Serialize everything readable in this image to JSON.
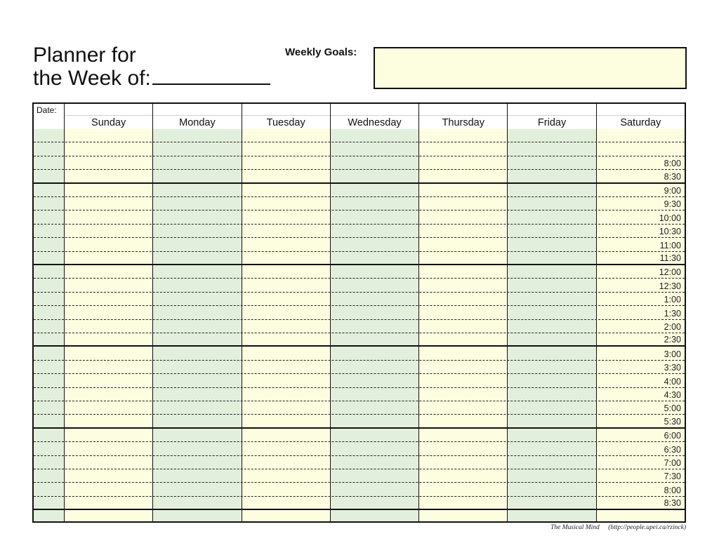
{
  "title": {
    "line1": "Planner for",
    "line2": "the Week of:"
  },
  "weekly_goals": {
    "label": "Weekly Goals:",
    "value": ""
  },
  "grid": {
    "date_label": "Date:",
    "days": [
      "Sunday",
      "Monday",
      "Tuesday",
      "Wednesday",
      "Thursday",
      "Friday",
      "Saturday"
    ],
    "day_shading": [
      "yellow",
      "green",
      "yellow",
      "green",
      "yellow",
      "green",
      "yellow"
    ],
    "blocks": [
      [
        "",
        "",
        "8:00",
        "8:30"
      ],
      [
        "9:00",
        "9:30",
        "10:00",
        "10:30",
        "11:00",
        "11:30"
      ],
      [
        "12:00",
        "12:30",
        "1:00",
        "1:30",
        "2:00",
        "2:30"
      ],
      [
        "3:00",
        "3:30",
        "4:00",
        "4:30",
        "5:00",
        "5:30"
      ],
      [
        "6:00",
        "6:30",
        "7:00",
        "7:30",
        "8:00",
        "8:30"
      ],
      [
        ""
      ]
    ]
  },
  "colors": {
    "yellow": "#fdfde0",
    "green": "#e2efdc",
    "border": "#111111"
  },
  "footer": {
    "brand": "The Musical Mind",
    "url": "(http://people.upei.ca/rzinck)"
  }
}
